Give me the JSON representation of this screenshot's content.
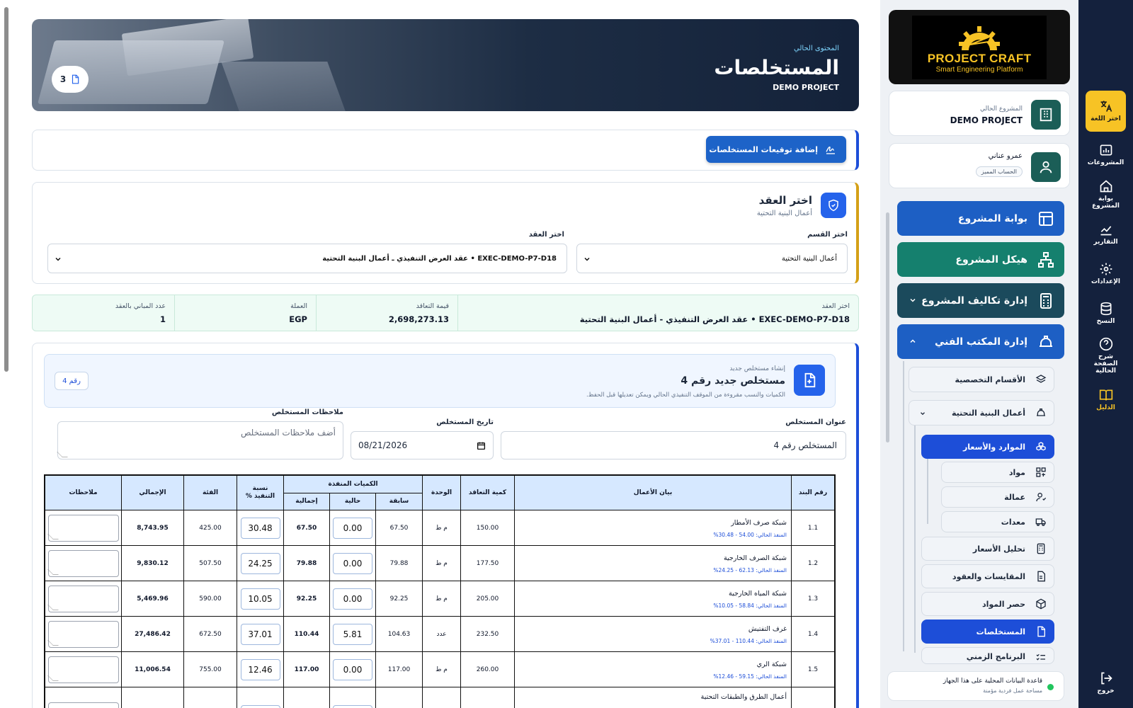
{
  "rail": {
    "items": [
      {
        "label": "اختر اللغة",
        "icon": "translate-icon"
      },
      {
        "label": "المشروعات",
        "icon": "projects-icon"
      },
      {
        "label": "بوابة المشروع",
        "icon": "home-icon"
      },
      {
        "label": "التقارير",
        "icon": "reports-icon"
      },
      {
        "label": "الإعدادات",
        "icon": "gear-icon"
      },
      {
        "label": "النسخ",
        "icon": "database-icon"
      },
      {
        "label": "شرح الصفحة الحالية",
        "icon": "help-icon"
      },
      {
        "label": "الدليل",
        "icon": "book-icon"
      },
      {
        "label": "خروج",
        "icon": "logout-icon"
      }
    ],
    "accent_color": "#f7c325"
  },
  "sidebar": {
    "logo": {
      "title": "PROJECT CRAFT",
      "subtitle": "Smart Engineering Platform"
    },
    "project_card": {
      "label": "المشروع الحالي",
      "value": "DEMO PROJECT"
    },
    "user_card": {
      "name": "عمرو عناني",
      "badge": "الحساب المميز"
    },
    "nav": [
      {
        "label": "بوابة المشروع",
        "color": "#1d5fc4"
      },
      {
        "label": "هيكل المشروع",
        "color": "#15806e"
      },
      {
        "label": "إدارة تكاليف المشروع",
        "color": "#1b4a5c"
      },
      {
        "label": "إدارة المكتب الفني",
        "color": "#1d5fc4"
      }
    ],
    "sub": {
      "specialized": "الأقسام التخصصية",
      "infra": "أعمال البنية التحتية",
      "resources": "الموارد والأسعار",
      "materials": "مواد",
      "labor": "عمالة",
      "equipment": "معدات",
      "price_analysis": "تحليل الأسعار",
      "contracts": "المقايسات والعقود",
      "material_takeoff": "حصر المواد",
      "invoices": "المستخلصات",
      "schedule": "البرنامج الزمني"
    },
    "db": {
      "title": "قاعدة البيانات المحلية على هذا الجهاز",
      "subtitle": "مساحة عمل فردية مؤمنة"
    }
  },
  "hero": {
    "kicker": "المحتوى الحالي",
    "title": "المستخلصات",
    "project": "DEMO PROJECT",
    "count": "3"
  },
  "actions": {
    "add_signatures": "إضافة توقيعات المستخلصات"
  },
  "contract_section": {
    "title": "اختر العقد",
    "subtitle": "أعمال البنية التحتية",
    "division_label": "اختر القسم",
    "division_value": "أعمال البنية التحتية",
    "contract_label": "اختر العقد",
    "contract_value": "EXEC-DEMO-P7-D18 • عقد العرض التنفيذي ـ أعمال البنية التحتية"
  },
  "info": {
    "contract_label": "اختر العقد",
    "contract_value": "EXEC-DEMO-P7-D18 • عقد العرض التنفيذي - أعمال البنية التحتية",
    "value_label": "قيمة التعاقد",
    "value": "2,698,273.13",
    "currency_label": "العملة",
    "currency": "EGP",
    "buildings_label": "عدد المباني بالعقد",
    "buildings": "1"
  },
  "new_invoice": {
    "kicker": "إنشاء مستخلص جديد",
    "title": "مستخلص جديد رقم 4",
    "subtitle": "الكميات والنسب مقروءة من الموقف التنفيذي الحالي ويمكن تعديلها قبل الحفظ.",
    "badge": "رقم 4",
    "title_label": "عنوان المستخلص",
    "title_value": "المستخلص رقم 4",
    "date_label": "تاريخ المستخلص",
    "date_value": "08/21/2026",
    "notes_label": "ملاحظات المستخلص",
    "notes_placeholder": "أضف ملاحظات المستخلص"
  },
  "table": {
    "headers": {
      "item_no": "رقم البند",
      "description": "بيان الأعمال",
      "contract_qty": "كمية التعاقد",
      "unit": "الوحدة",
      "executed": "الكميات المنفذة",
      "previous": "سابقة",
      "current": "حالية",
      "total_qty": "إجمالية",
      "percent": "نسبة التنفيذ %",
      "rate": "الفئة",
      "total": "الإجمالي",
      "notes": "ملاحظات"
    },
    "rows": [
      {
        "no": "1.1",
        "desc": "شبكة صرف الأمطار",
        "sub": "المنفذ الحالي: 54.00 - 30.48%",
        "contract": "150.00",
        "unit": "م ط",
        "prev": "67.50",
        "cur": "0.00",
        "tot": "67.50",
        "pct": "30.48",
        "rate": "425.00",
        "total": "8,743.95"
      },
      {
        "no": "1.2",
        "desc": "شبكة الصرف الخارجية",
        "sub": "المنفذ الحالي: 62.13 - 24.25%",
        "contract": "177.50",
        "unit": "م ط",
        "prev": "79.88",
        "cur": "0.00",
        "tot": "79.88",
        "pct": "24.25",
        "rate": "507.50",
        "total": "9,830.12"
      },
      {
        "no": "1.3",
        "desc": "شبكة المياه الخارجية",
        "sub": "المنفذ الحالي: 58.84 - 10.05%",
        "contract": "205.00",
        "unit": "م ط",
        "prev": "92.25",
        "cur": "0.00",
        "tot": "92.25",
        "pct": "10.05",
        "rate": "590.00",
        "total": "5,469.96"
      },
      {
        "no": "1.4",
        "desc": "غرف التفتيش",
        "sub": "المنفذ الحالي: 110.44 - 37.01%",
        "contract": "232.50",
        "unit": "عدد",
        "prev": "104.63",
        "cur": "5.81",
        "tot": "110.44",
        "pct": "37.01",
        "rate": "672.50",
        "total": "27,486.42"
      },
      {
        "no": "1.5",
        "desc": "شبكة الري",
        "sub": "المنفذ الحالي: 59.15 - 12.46%",
        "contract": "260.00",
        "unit": "م ط",
        "prev": "117.00",
        "cur": "0.00",
        "tot": "117.00",
        "pct": "12.46",
        "rate": "755.00",
        "total": "11,006.54"
      },
      {
        "no": "",
        "desc": "أعمال الطرق والطبقات التحتية",
        "sub": "",
        "contract": "",
        "unit": "",
        "prev": "",
        "cur": "",
        "tot": "",
        "pct": "",
        "rate": "",
        "total": ""
      }
    ]
  }
}
